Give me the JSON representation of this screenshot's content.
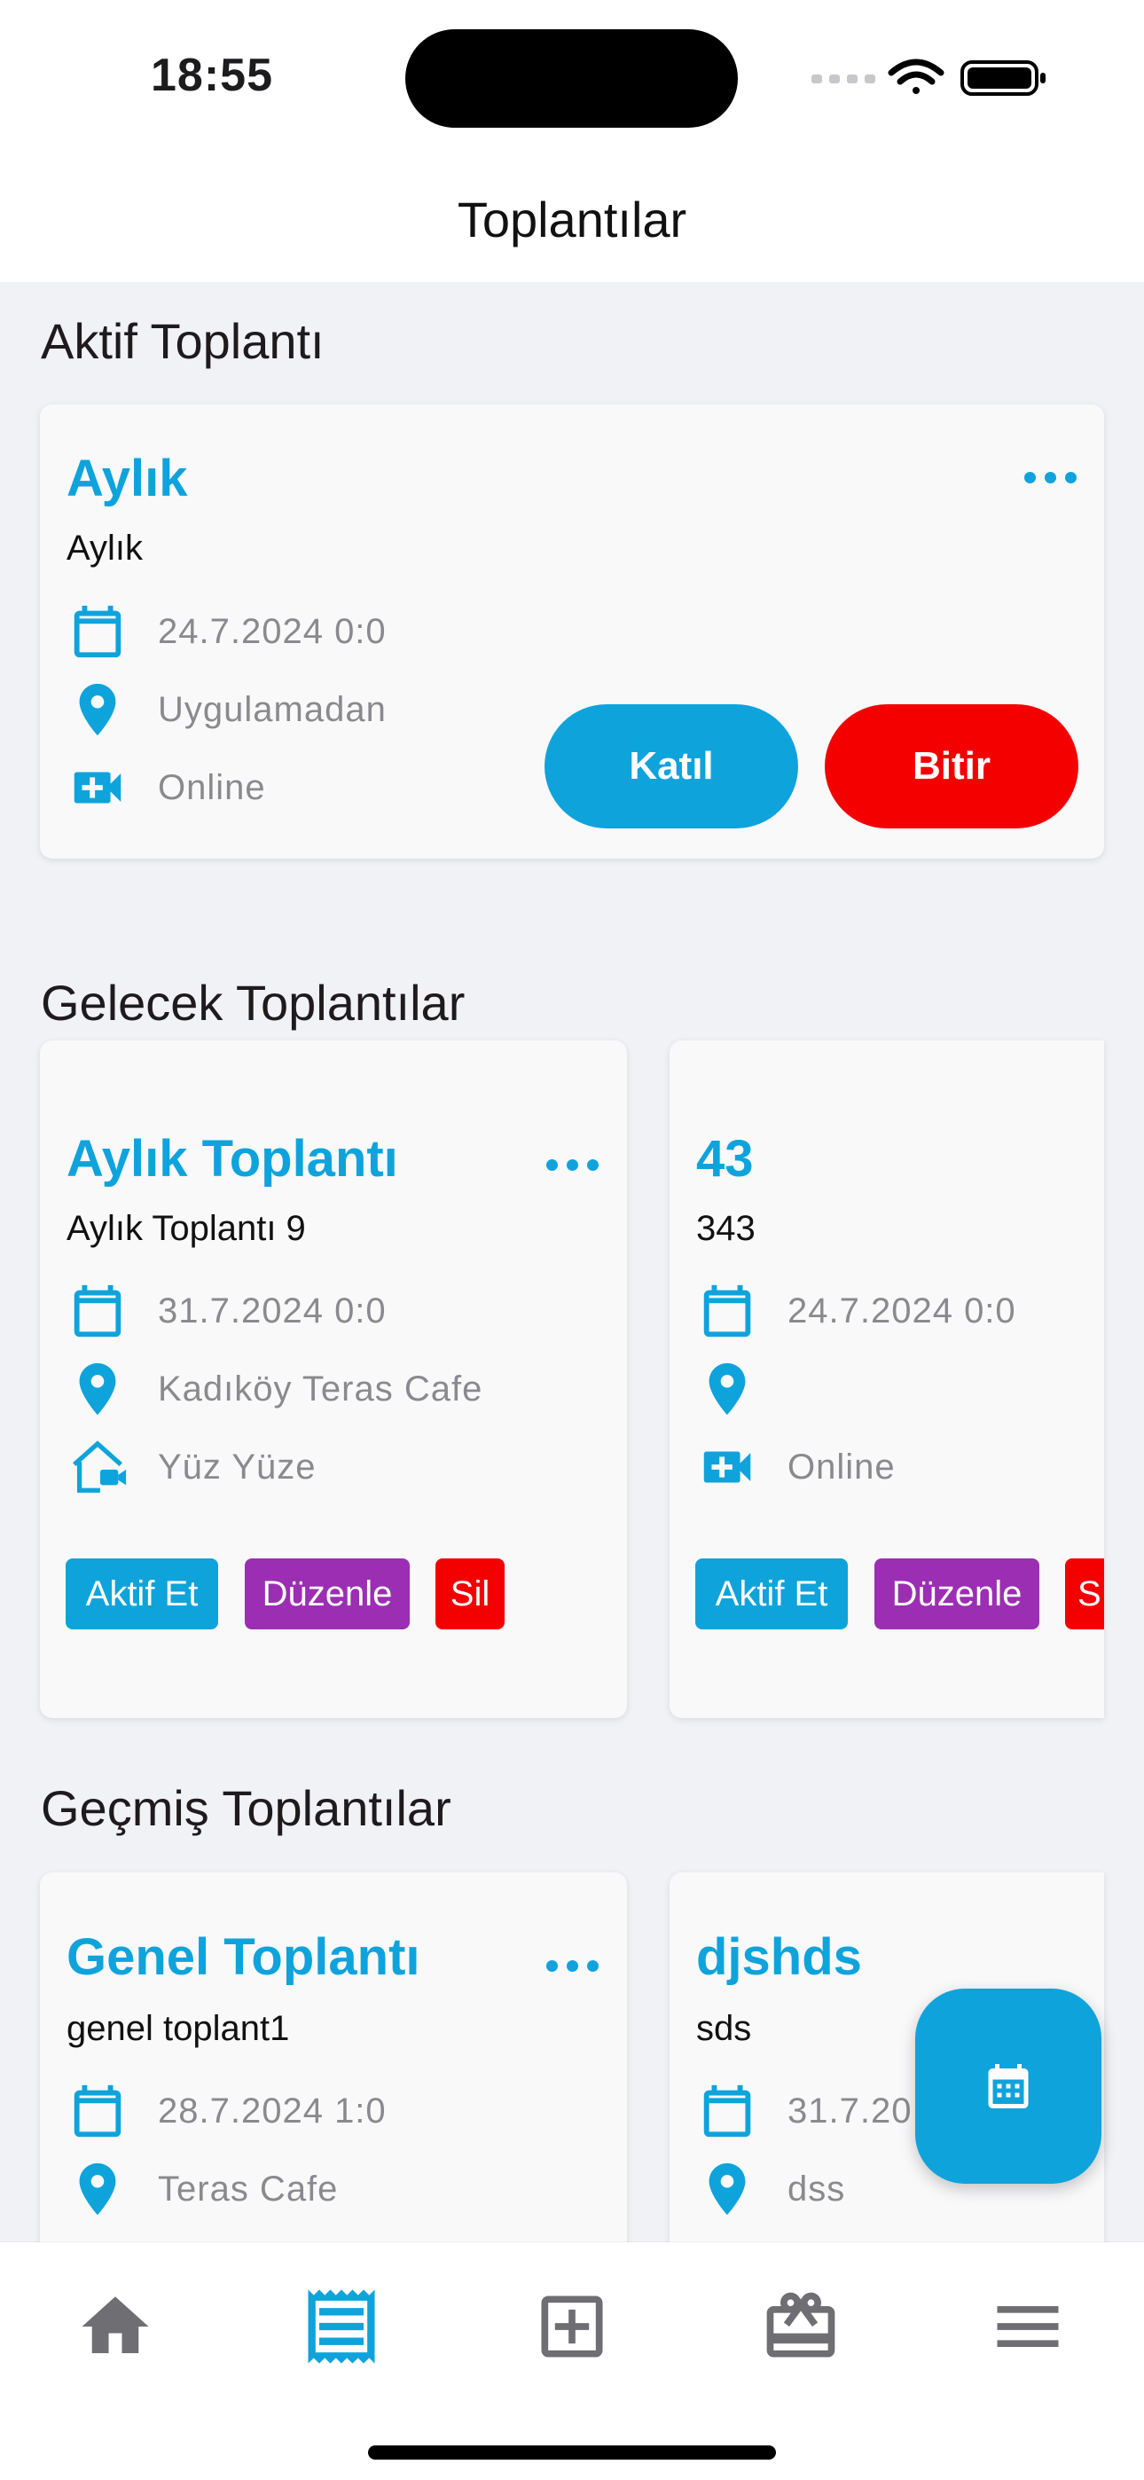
{
  "status_bar": {
    "time": "18:55"
  },
  "header": {
    "title": "Toplantılar"
  },
  "sections": {
    "active": "Aktif Toplantı",
    "upcoming": "Gelecek Toplantılar",
    "past": "Geçmiş Toplantılar"
  },
  "active_meeting": {
    "title": "Aylık",
    "subtitle": "Aylık",
    "date": "24.7.2024 0:0",
    "location": "Uygulamadan",
    "type": "Online",
    "join_label": "Katıl",
    "end_label": "Bitir"
  },
  "upcoming_meetings": [
    {
      "title": "Aylık Toplantı",
      "subtitle": "Aylık Toplantı 9",
      "date": "31.7.2024 0:0",
      "location": "Kadıköy Teras Cafe",
      "type": "Yüz Yüze",
      "activate_label": "Aktif Et",
      "edit_label": "Düzenle",
      "delete_label": "Sil"
    },
    {
      "title": "43",
      "subtitle": "343",
      "date": "24.7.2024 0:0",
      "location": "",
      "type": "Online",
      "activate_label": "Aktif Et",
      "edit_label": "Düzenle",
      "delete_label": "S"
    }
  ],
  "past_meetings": [
    {
      "title": "Genel Toplantı",
      "subtitle": "genel toplant1",
      "date": "28.7.2024 1:0",
      "location": "Teras Cafe"
    },
    {
      "title": "djshds",
      "subtitle": "sds",
      "date": "31.7.20",
      "location": "dss"
    }
  ],
  "colors": {
    "accent": "#0fa3dc",
    "danger": "#f50000",
    "edit": "#9b2eb3",
    "background": "#f1f2f6",
    "muted_text": "#8a8a8e"
  },
  "tabbar": {
    "items": [
      "home-icon",
      "meetings-icon",
      "add-box-icon",
      "gift-card-icon",
      "menu-icon"
    ],
    "active": "meetings-icon"
  }
}
